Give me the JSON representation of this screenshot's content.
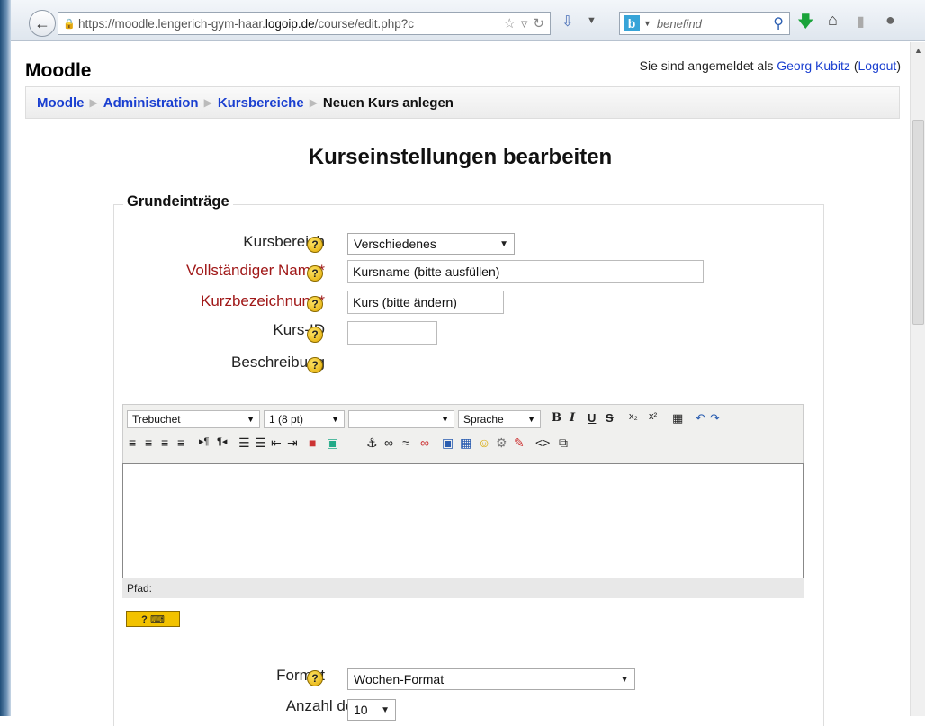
{
  "browser": {
    "url_prefix": "https://moodle.lengerich-gym-haar.",
    "url_host": "logoip.de",
    "url_path": "/course/edit.php?c",
    "search_text": "benefind",
    "search_engine_letter": "b"
  },
  "site": {
    "title": "Moodle",
    "login_prefix": "Sie sind angemeldet als",
    "user_name": "Georg Kubitz",
    "logout_label": "Logout"
  },
  "breadcrumb": {
    "items": [
      "Moodle",
      "Administration",
      "Kursbereiche"
    ],
    "current": "Neuen Kurs anlegen"
  },
  "page": {
    "heading": "Kurseinstellungen bearbeiten",
    "section_legend": "Grundeinträge"
  },
  "form": {
    "category_label": "Kursbereich",
    "category_value": "Verschiedenes",
    "fullname_label": "Vollständiger Name*",
    "fullname_value": "Kursname (bitte ausfüllen)",
    "shortname_label": "Kurzbezeichnung*",
    "shortname_value": "Kurs (bitte ändern)",
    "idnumber_label": "Kurs-ID",
    "idnumber_value": "",
    "summary_label": "Beschreibung",
    "format_label": "Format",
    "format_value": "Wochen-Format",
    "numsections_label": "Anzahl der",
    "numsections_value": "10"
  },
  "editor": {
    "font_family": "Trebuchet",
    "font_size": "1 (8 pt)",
    "format_value": "",
    "language": "Sprache",
    "path_label": "Pfad:"
  },
  "colors": {
    "link": "#1a3fd0",
    "required": "#a01818",
    "help_icon": "#f2c200"
  }
}
